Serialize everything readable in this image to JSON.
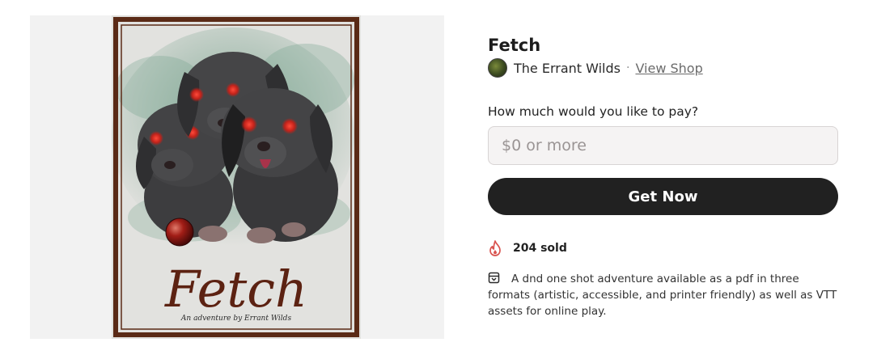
{
  "product": {
    "title": "Fetch",
    "cover": {
      "title_text": "Fetch",
      "byline": "An adventure by Errant Wilds"
    }
  },
  "seller": {
    "name": "The Errant Wilds",
    "separator": "·",
    "view_shop_label": "View Shop"
  },
  "purchase": {
    "pay_label": "How much would you like to pay?",
    "pay_placeholder": "$0 or more",
    "pay_value": "",
    "cta_label": "Get Now"
  },
  "stats": {
    "sold_text": "204 sold"
  },
  "description": {
    "text": "A dnd one shot adventure available as a pdf in three formats (artistic, accessible, and printer friendly) as well as VTT assets for online play."
  },
  "icons": {
    "sold": "flame-icon",
    "description": "box-icon"
  },
  "colors": {
    "cta_background": "#212121",
    "sold_icon": "#d9534f",
    "cover_border": "#5a2a16",
    "cover_title": "#5c2212"
  }
}
